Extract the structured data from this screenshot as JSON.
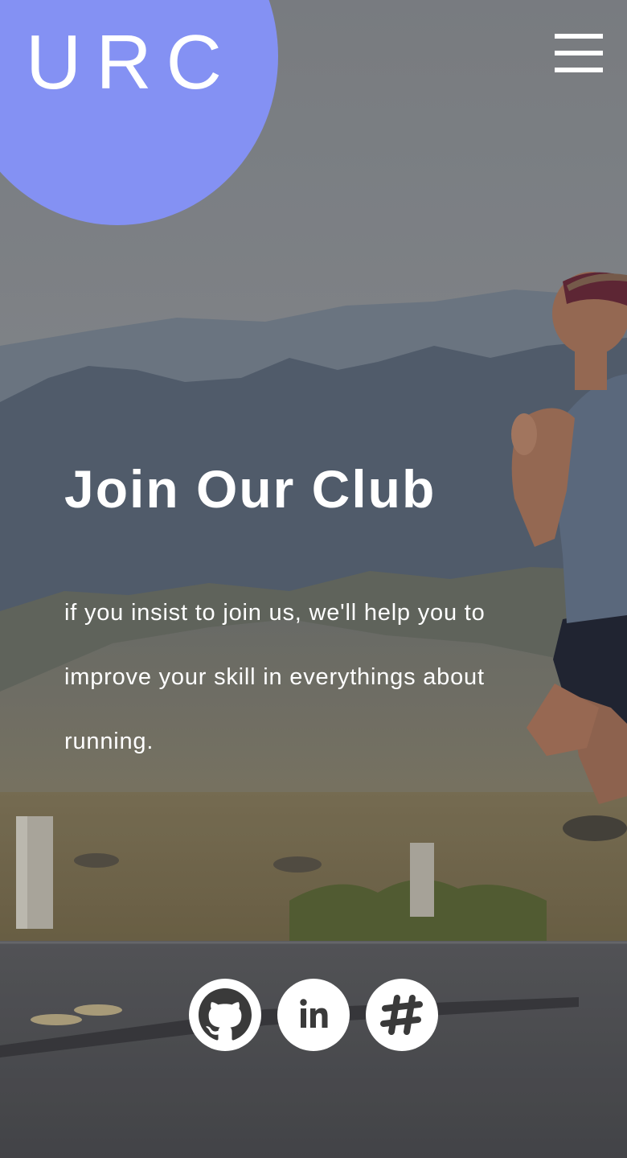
{
  "brand": {
    "logo_text": "URC",
    "accent_color": "#8491f3"
  },
  "header": {
    "menu_icon": "hamburger-menu-icon"
  },
  "hero": {
    "title": "Join Our Club",
    "body": "if you insist to join us, we'll help you to improve your skill in everythings about running.",
    "background_image": "runner on desert road with mountains"
  },
  "social": {
    "items": [
      {
        "name": "github",
        "icon": "github-icon"
      },
      {
        "name": "linkedin",
        "icon": "linkedin-icon",
        "glyph": "in"
      },
      {
        "name": "slack",
        "icon": "slack-icon",
        "glyph": "#"
      }
    ]
  }
}
